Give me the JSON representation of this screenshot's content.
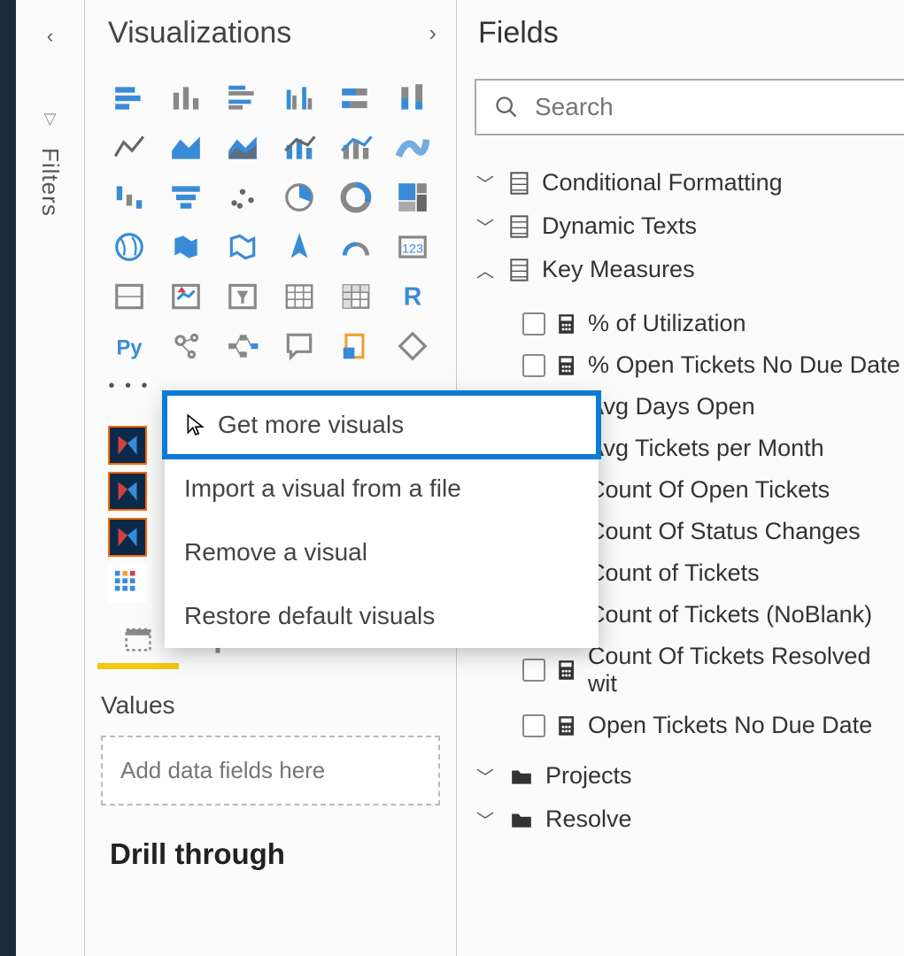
{
  "filters_label": "Filters",
  "viz": {
    "title": "Visualizations",
    "more_dots": "…",
    "context_menu": [
      "Get more visuals",
      "Import a visual from a file",
      "Remove a visual",
      "Restore default visuals"
    ],
    "values_label": "Values",
    "values_placeholder": "Add data fields here",
    "drill_label": "Drill through"
  },
  "fields": {
    "title": "Fields",
    "search_placeholder": "Search",
    "tables": [
      {
        "name": "Conditional Formatting",
        "expanded": false,
        "type": "table"
      },
      {
        "name": "Dynamic Texts",
        "expanded": false,
        "type": "table"
      },
      {
        "name": "Key Measures",
        "expanded": true,
        "type": "table",
        "measures": [
          "% of Utilization",
          "% Open Tickets No Due Date",
          "Avg Days Open",
          "Avg Tickets per Month",
          "Count Of Open Tickets",
          "Count Of Status Changes",
          "Count of Tickets",
          "Count of Tickets (NoBlank)",
          "Count Of Tickets Resolved wit",
          "Open Tickets No Due Date"
        ]
      },
      {
        "name": "Projects",
        "expanded": false,
        "type": "folder"
      },
      {
        "name": "Resolve",
        "expanded": false,
        "type": "folder"
      }
    ]
  }
}
